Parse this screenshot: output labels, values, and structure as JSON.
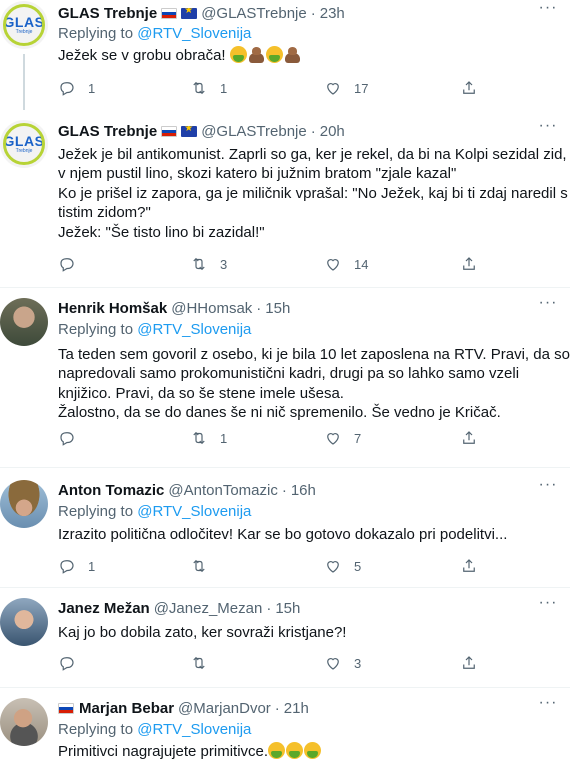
{
  "tweets": [
    {
      "name": "GLAS Trebnje",
      "flags": [
        "si",
        "eu"
      ],
      "handle": "@GLASTrebnje",
      "sep": "·",
      "time": "23h",
      "replying_prefix": "Replying to ",
      "replying_mention": "@RTV_Slovenija",
      "avatar_text": "GLAS",
      "avatar_sub": "Trebnje",
      "lines": [
        "Ježek se v grobu obrača!"
      ],
      "emojis": [
        "face-vomiting-emoji",
        "pile-of-poo-emoji",
        "face-vomiting-emoji",
        "pile-of-poo-emoji"
      ],
      "replies": "1",
      "retweets": "1",
      "likes": "17"
    },
    {
      "name": "GLAS Trebnje",
      "flags": [
        "si",
        "eu"
      ],
      "handle": "@GLASTrebnje",
      "sep": "·",
      "time": "20h",
      "avatar_text": "GLAS",
      "avatar_sub": "Trebnje",
      "lines": [
        "Ježek je bil antikomunist. Zaprli so ga, ker je rekel, da bi na Kolpi sezidal zid,",
        "v njem pustil lino, skozi katero bi južnim bratom \"zjale kazal\"",
        "Ko je prišel iz zapora, ga je miličnik vprašal: \"No Ježek, kaj bi ti zdaj naredil s",
        "tistim zidom?\"",
        "Ježek: \"Še tisto lino bi zazidal!\""
      ],
      "replies": "",
      "retweets": "3",
      "likes": "14"
    },
    {
      "name": "Henrik Homšak",
      "handle": "@HHomsak",
      "sep": "·",
      "time": "15h",
      "replying_prefix": "Replying to ",
      "replying_mention": "@RTV_Slovenija",
      "lines": [
        "Ta teden sem govoril z osebo, ki je bila 10 let zaposlena na RTV. Pravi, da so",
        "napredovali samo prokomunistični kadri, drugi pa so lahko samo vzeli",
        "knjižico. Pravi, da so še stene imele ušesa.",
        "Žalostno, da se do danes še ni nič spremenilo. Še vedno je Kričač."
      ],
      "replies": "",
      "retweets": "1",
      "likes": "7"
    },
    {
      "name": "Anton Tomazic",
      "handle": "@AntonTomazic",
      "sep": "·",
      "time": "16h",
      "replying_prefix": "Replying to ",
      "replying_mention": "@RTV_Slovenija",
      "lines": [
        "Izrazito politična odločitev! Kar se bo gotovo dokazalo pri podelitvi..."
      ],
      "replies": "1",
      "retweets": "",
      "likes": "5"
    },
    {
      "name": "Janez Mežan",
      "handle": "@Janez_Mezan",
      "sep": "·",
      "time": "15h",
      "lines": [
        "Kaj jo bo dobila zato, ker sovraži kristjane?!"
      ],
      "replies": "",
      "retweets": "",
      "likes": "3"
    },
    {
      "name": "Marjan Bebar",
      "flags": [
        "si"
      ],
      "handle": "@MarjanDvor",
      "sep": "·",
      "time": "21h",
      "replying_prefix": "Replying to ",
      "replying_mention": "@RTV_Slovenija",
      "lines": [
        "Primitivci nagrajujete primitivce."
      ],
      "emojis": [
        "face-vomiting-emoji",
        "face-vomiting-emoji",
        "face-vomiting-emoji"
      ]
    }
  ],
  "icons": {
    "reply": "reply-icon",
    "retweet": "retweet-icon",
    "like": "heart-icon",
    "share": "share-icon",
    "more": "more-icon"
  },
  "colors": {
    "link": "#1d9bf0",
    "secondary_text": "#536471",
    "divider": "#eff3f4"
  }
}
